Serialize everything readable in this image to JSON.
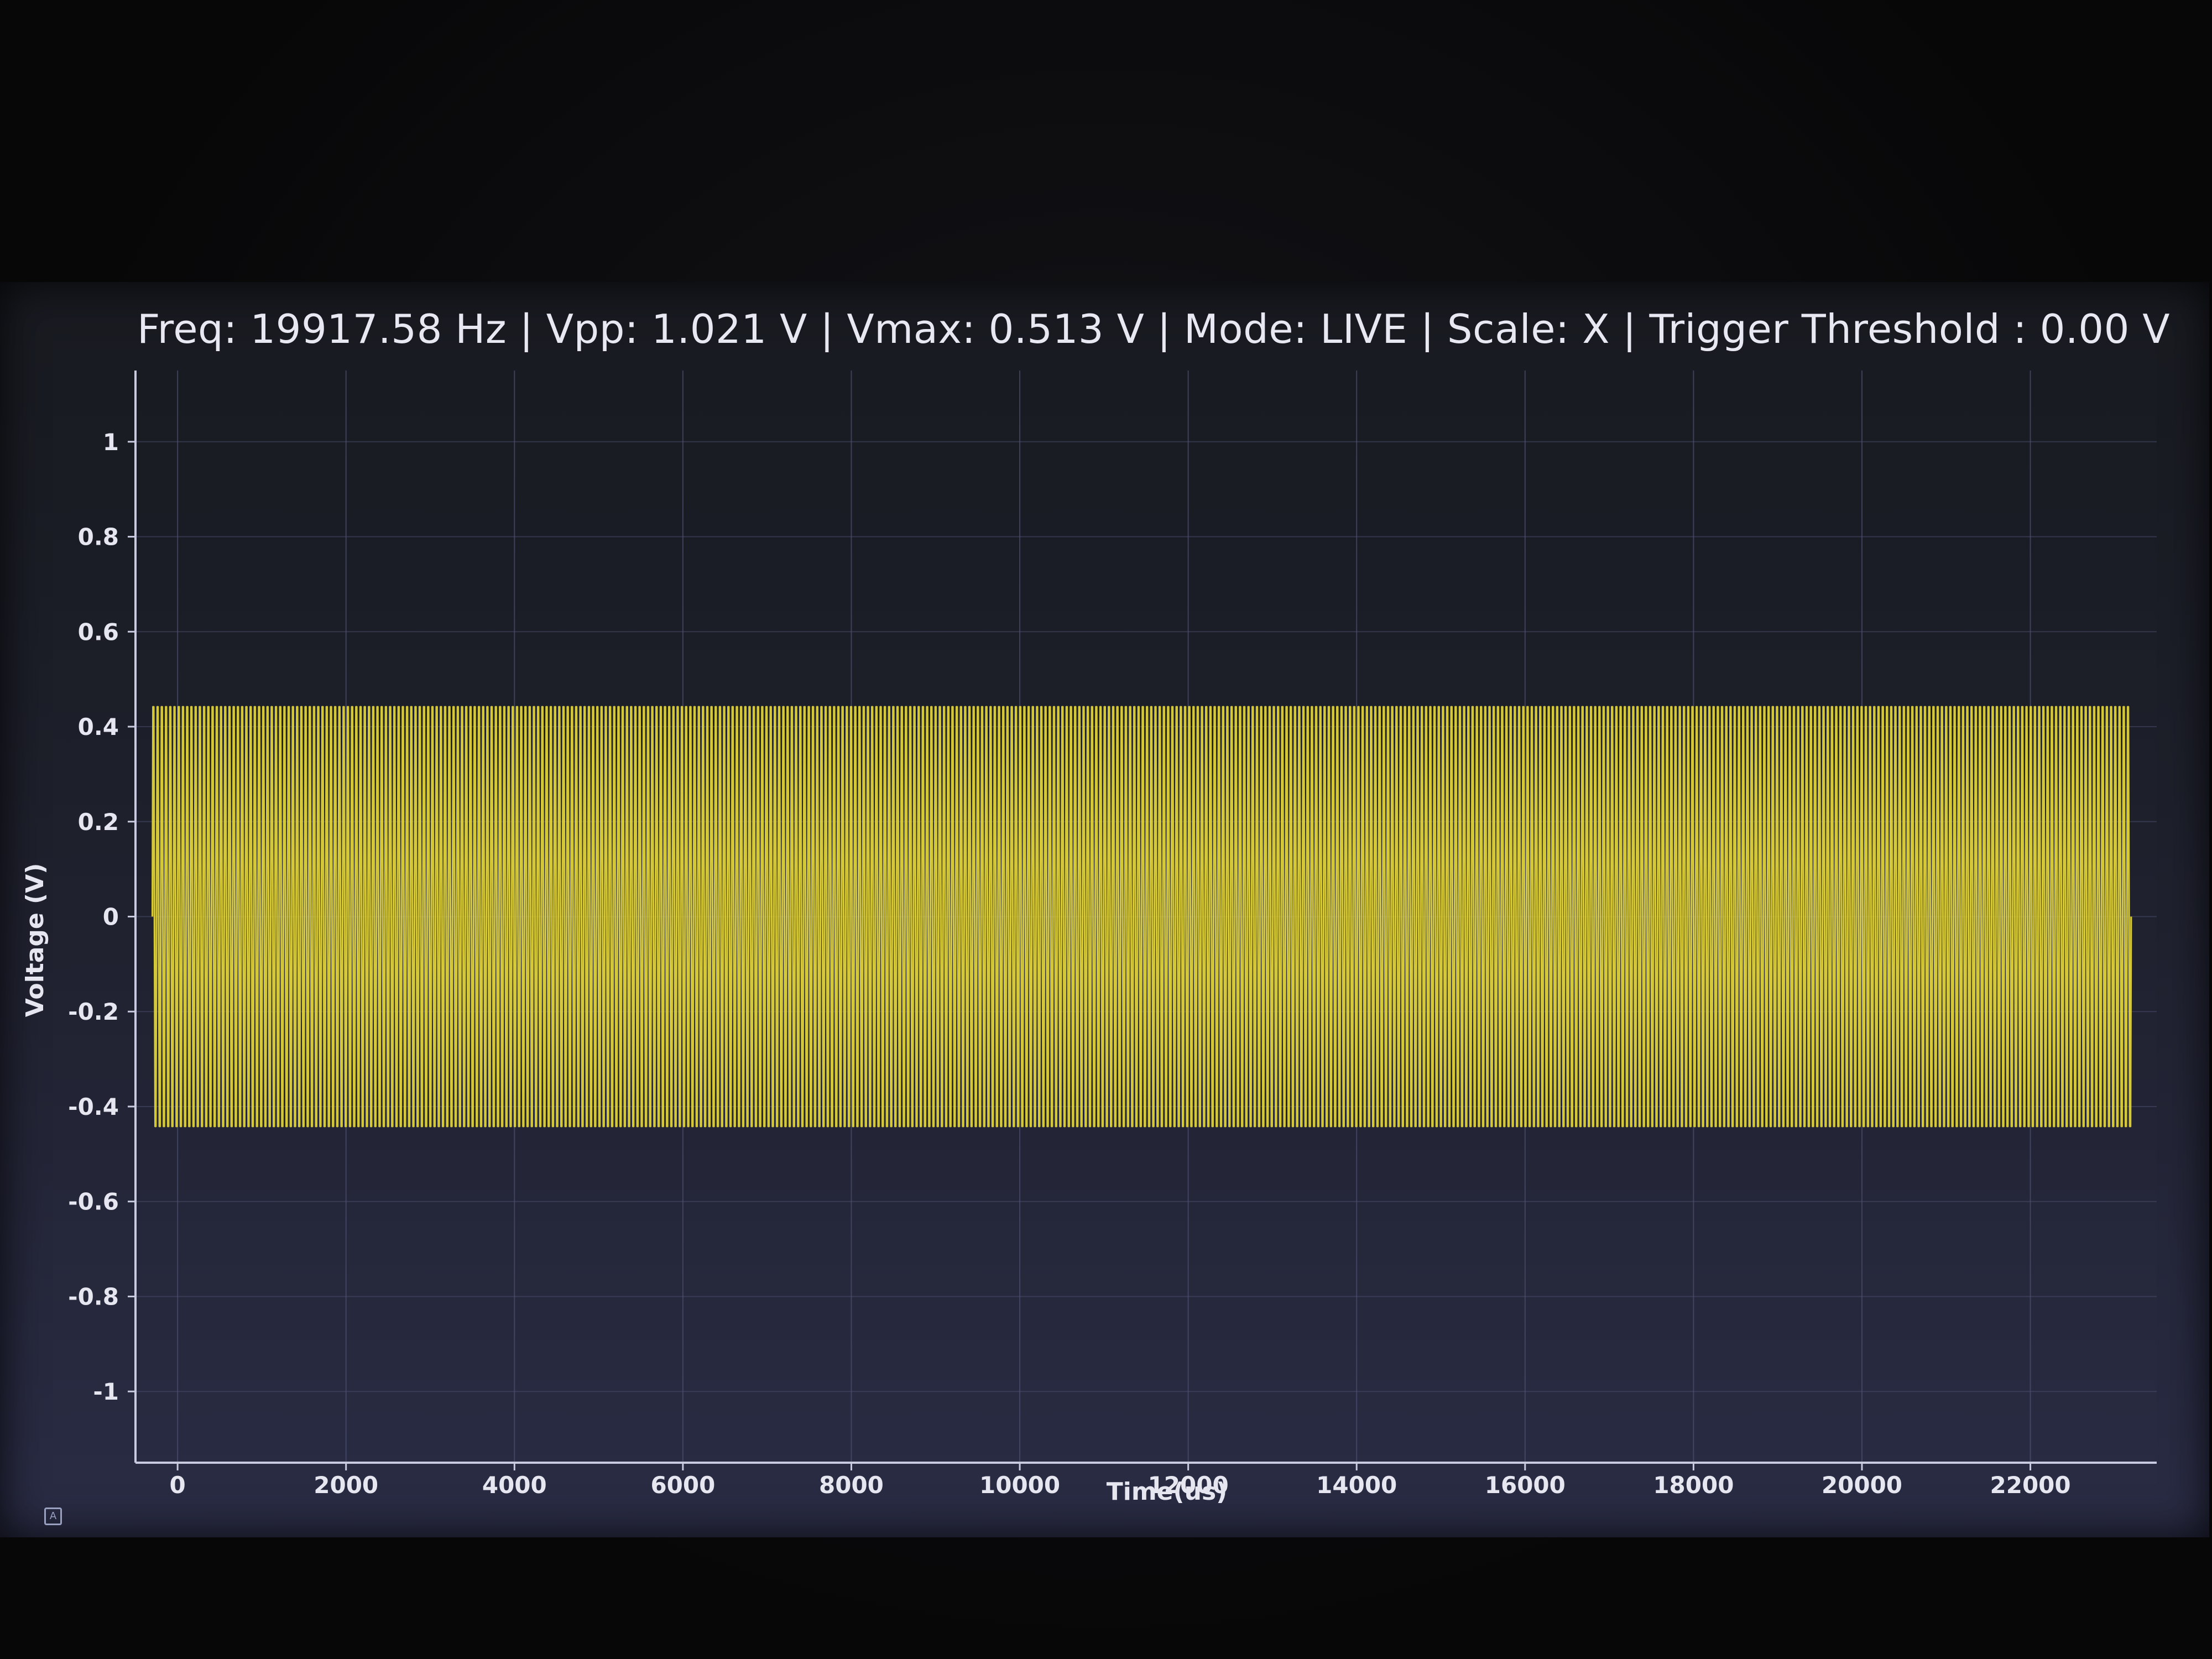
{
  "status": {
    "text": "Freq: 19917.58 Hz | Vpp: 1.021 V | Vmax: 0.513 V | Mode: LIVE | Scale: X | Trigger Threshold : 0.00 V"
  },
  "chart_data": {
    "type": "line",
    "xlabel": "Time(us)",
    "ylabel": "Voltage (V)",
    "xlim": [
      -500,
      23500
    ],
    "ylim": [
      -1.15,
      1.15
    ],
    "x_ticks": [
      0,
      2000,
      4000,
      6000,
      8000,
      10000,
      12000,
      14000,
      16000,
      18000,
      20000,
      22000
    ],
    "y_ticks": [
      1,
      0.8,
      0.6,
      0.4,
      0.2,
      0,
      -0.2,
      -0.4,
      -0.6,
      -0.8,
      -1
    ],
    "y_tick_labels": [
      "1",
      "0.8",
      "0.6",
      "0.4",
      "0.2",
      "0",
      "-0.2",
      "-0.4",
      "-0.6",
      "-0.8",
      "-1"
    ],
    "x_tick_labels": [
      "0",
      "2000",
      "4000",
      "6000",
      "8000",
      "10000",
      "12000",
      "14000",
      "16000",
      "18000",
      "20000",
      "22000"
    ],
    "grid": true,
    "series": [
      {
        "color": "#e4d63a",
        "waveform": "sine",
        "frequency_hz": 19917.58,
        "amplitude_v": 0.51,
        "offset_v": 0.0,
        "x_start": -300,
        "x_end": 23200
      }
    ]
  },
  "colors": {
    "trace": "#e4d63a",
    "grid": "#4c5070",
    "axis": "#c8cbe0",
    "text": "#e8e8f2"
  },
  "icons": {
    "corner": "plot-options-icon"
  }
}
